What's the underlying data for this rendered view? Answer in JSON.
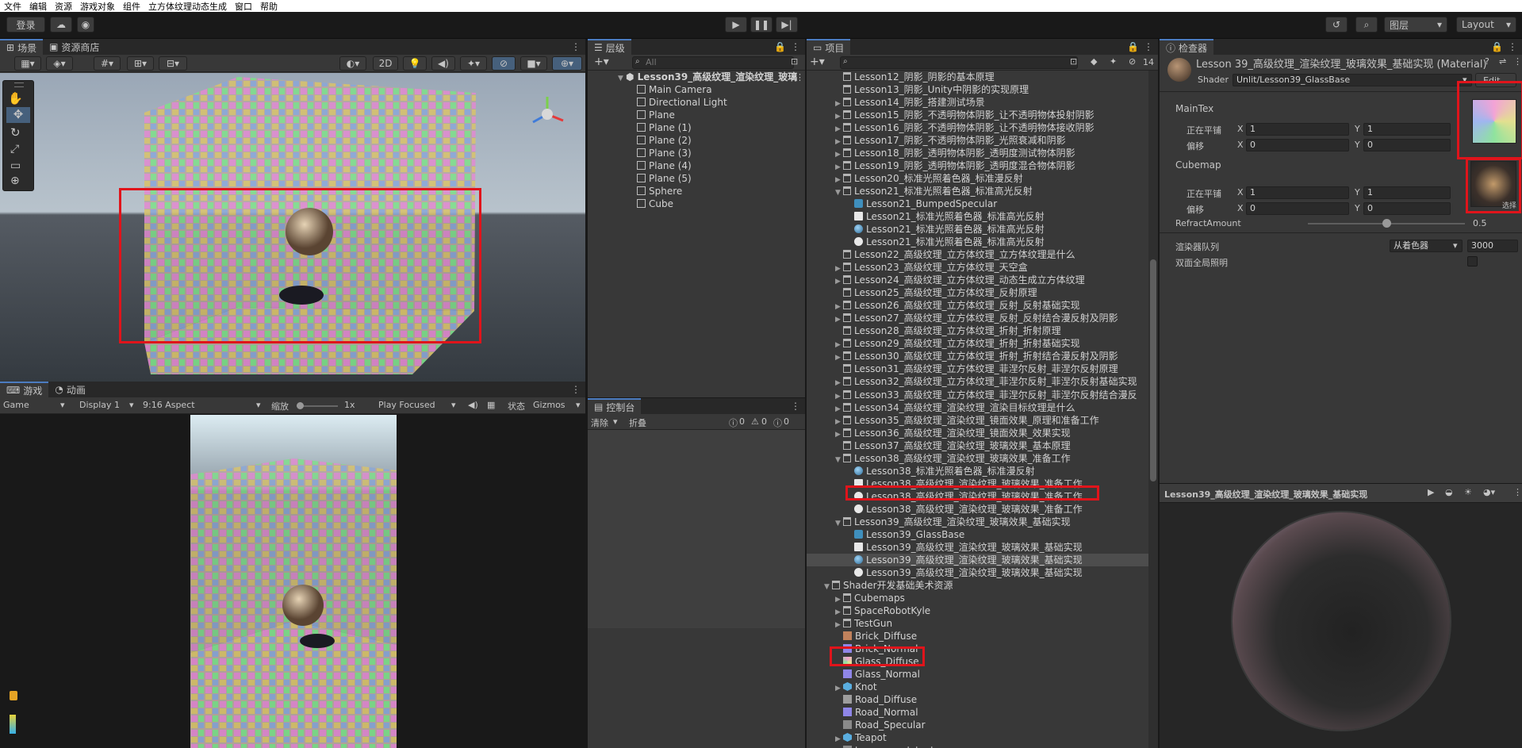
{
  "menu": [
    "文件",
    "编辑",
    "资源",
    "游戏对象",
    "组件",
    "立方体纹理动态生成",
    "窗口",
    "帮助"
  ],
  "toolbar": {
    "login": "登录",
    "layers": "图层",
    "layout": "Layout"
  },
  "scene_panel": {
    "tab_scene": "场景",
    "tab_store": "资源商店",
    "mode_2d": "2D"
  },
  "game_panel": {
    "tab_game": "游戏",
    "tab_animation": "动画",
    "game_select": "Game",
    "display": "Display 1",
    "aspect": "9:16 Aspect",
    "scale_label": "缩放",
    "scale_value": "1x",
    "play_focused": "Play Focused",
    "stats": "状态",
    "gizmos": "Gizmos"
  },
  "hierarchy": {
    "tab": "层级",
    "search_placeholder": "All",
    "scene_name": "Lesson39_高级纹理_渲染纹理_玻璃",
    "items": [
      "Main Camera",
      "Directional Light",
      "Plane",
      "Plane (1)",
      "Plane (2)",
      "Plane (3)",
      "Plane (4)",
      "Plane (5)",
      "Sphere",
      "Cube"
    ]
  },
  "console": {
    "tab": "控制台",
    "clear": "清除",
    "collapse": "折叠",
    "count_log": "0",
    "count_warn": "0",
    "count_err": "0"
  },
  "project": {
    "tab": "项目",
    "item_count": "14",
    "items": [
      {
        "text": "Lesson12_阴影_阴影的基本原理",
        "indent": 1,
        "kind": "folder",
        "arrow": ""
      },
      {
        "text": "Lesson13_阴影_Unity中阴影的实现原理",
        "indent": 1,
        "kind": "folder",
        "arrow": ""
      },
      {
        "text": "Lesson14_阴影_搭建测试场景",
        "indent": 1,
        "kind": "folder",
        "arrow": "▶"
      },
      {
        "text": "Lesson15_阴影_不透明物体阴影_让不透明物体投射阴影",
        "indent": 1,
        "kind": "folder",
        "arrow": "▶"
      },
      {
        "text": "Lesson16_阴影_不透明物体阴影_让不透明物体接收阴影",
        "indent": 1,
        "kind": "folder",
        "arrow": "▶"
      },
      {
        "text": "Lesson17_阴影_不透明物体阴影_光照衰减和阴影",
        "indent": 1,
        "kind": "folder",
        "arrow": "▶"
      },
      {
        "text": "Lesson18_阴影_透明物体阴影_透明度测试物体阴影",
        "indent": 1,
        "kind": "folder",
        "arrow": "▶"
      },
      {
        "text": "Lesson19_阴影_透明物体阴影_透明度混合物体阴影",
        "indent": 1,
        "kind": "folder",
        "arrow": "▶"
      },
      {
        "text": "Lesson20_标准光照着色器_标准漫反射",
        "indent": 1,
        "kind": "folder",
        "arrow": "▶"
      },
      {
        "text": "Lesson21_标准光照着色器_标准高光反射",
        "indent": 1,
        "kind": "folder",
        "arrow": "▼"
      },
      {
        "text": "Lesson21_BumpedSpecular",
        "indent": 2,
        "kind": "script",
        "arrow": ""
      },
      {
        "text": "Lesson21_标准光照着色器_标准高光反射",
        "indent": 2,
        "kind": "shader",
        "arrow": ""
      },
      {
        "text": "Lesson21_标准光照着色器_标准高光反射",
        "indent": 2,
        "kind": "material",
        "arrow": ""
      },
      {
        "text": "Lesson21_标准光照着色器_标准高光反射",
        "indent": 2,
        "kind": "scene",
        "arrow": ""
      },
      {
        "text": "Lesson22_高级纹理_立方体纹理_立方体纹理是什么",
        "indent": 1,
        "kind": "folder",
        "arrow": ""
      },
      {
        "text": "Lesson23_高级纹理_立方体纹理_天空盒",
        "indent": 1,
        "kind": "folder",
        "arrow": "▶"
      },
      {
        "text": "Lesson24_高级纹理_立方体纹理_动态生成立方体纹理",
        "indent": 1,
        "kind": "folder",
        "arrow": "▶"
      },
      {
        "text": "Lesson25_高级纹理_立方体纹理_反射原理",
        "indent": 1,
        "kind": "folder",
        "arrow": ""
      },
      {
        "text": "Lesson26_高级纹理_立方体纹理_反射_反射基础实现",
        "indent": 1,
        "kind": "folder",
        "arrow": "▶"
      },
      {
        "text": "Lesson27_高级纹理_立方体纹理_反射_反射结合漫反射及阴影",
        "indent": 1,
        "kind": "folder",
        "arrow": "▶"
      },
      {
        "text": "Lesson28_高级纹理_立方体纹理_折射_折射原理",
        "indent": 1,
        "kind": "folder",
        "arrow": ""
      },
      {
        "text": "Lesson29_高级纹理_立方体纹理_折射_折射基础实现",
        "indent": 1,
        "kind": "folder",
        "arrow": "▶"
      },
      {
        "text": "Lesson30_高级纹理_立方体纹理_折射_折射结合漫反射及阴影",
        "indent": 1,
        "kind": "folder",
        "arrow": "▶"
      },
      {
        "text": "Lesson31_高级纹理_立方体纹理_菲涅尔反射_菲涅尔反射原理",
        "indent": 1,
        "kind": "folder",
        "arrow": ""
      },
      {
        "text": "Lesson32_高级纹理_立方体纹理_菲涅尔反射_菲涅尔反射基础实现",
        "indent": 1,
        "kind": "folder",
        "arrow": "▶"
      },
      {
        "text": "Lesson33_高级纹理_立方体纹理_菲涅尔反射_菲涅尔反射结合漫反",
        "indent": 1,
        "kind": "folder",
        "arrow": "▶"
      },
      {
        "text": "Lesson34_高级纹理_渲染纹理_渲染目标纹理是什么",
        "indent": 1,
        "kind": "folder",
        "arrow": "▶"
      },
      {
        "text": "Lesson35_高级纹理_渲染纹理_镜面效果_原理和准备工作",
        "indent": 1,
        "kind": "folder",
        "arrow": "▶"
      },
      {
        "text": "Lesson36_高级纹理_渲染纹理_镜面效果_效果实现",
        "indent": 1,
        "kind": "folder",
        "arrow": "▶"
      },
      {
        "text": "Lesson37_高级纹理_渲染纹理_玻璃效果_基本原理",
        "indent": 1,
        "kind": "folder",
        "arrow": ""
      },
      {
        "text": "Lesson38_高级纹理_渲染纹理_玻璃效果_准备工作",
        "indent": 1,
        "kind": "folder",
        "arrow": "▼"
      },
      {
        "text": "Lesson38_标准光照着色器_标准漫反射",
        "indent": 2,
        "kind": "material",
        "arrow": ""
      },
      {
        "text": "Lesson38_高级纹理_渲染纹理_玻璃效果_准备工作",
        "indent": 2,
        "kind": "shader",
        "arrow": ""
      },
      {
        "text": "Lesson38_高级纹理_渲染纹理_玻璃效果_准备工作",
        "indent": 2,
        "kind": "scene",
        "arrow": ""
      },
      {
        "text": "Lesson38_高级纹理_渲染纹理_玻璃效果_准备工作",
        "indent": 2,
        "kind": "scene",
        "arrow": ""
      },
      {
        "text": "Lesson39_高级纹理_渲染纹理_玻璃效果_基础实现",
        "indent": 1,
        "kind": "folder",
        "arrow": "▼"
      },
      {
        "text": "Lesson39_GlassBase",
        "indent": 2,
        "kind": "script",
        "arrow": ""
      },
      {
        "text": "Lesson39_高级纹理_渲染纹理_玻璃效果_基础实现",
        "indent": 2,
        "kind": "shader",
        "arrow": ""
      },
      {
        "text": "Lesson39_高级纹理_渲染纹理_玻璃效果_基础实现",
        "indent": 2,
        "kind": "material",
        "arrow": "",
        "selected": true
      },
      {
        "text": "Lesson39_高级纹理_渲染纹理_玻璃效果_基础实现",
        "indent": 2,
        "kind": "scene",
        "arrow": ""
      },
      {
        "text": "Shader开发基础美术资源",
        "indent": 0,
        "kind": "folder",
        "arrow": "▼"
      },
      {
        "text": "Cubemaps",
        "indent": 1,
        "kind": "folder",
        "arrow": "▶"
      },
      {
        "text": "SpaceRobotKyle",
        "indent": 1,
        "kind": "folder",
        "arrow": "▶"
      },
      {
        "text": "TestGun",
        "indent": 1,
        "kind": "folder",
        "arrow": "▶"
      },
      {
        "text": "Brick_Diffuse",
        "indent": 1,
        "kind": "tex-brick",
        "arrow": ""
      },
      {
        "text": "Brick_Normal",
        "indent": 1,
        "kind": "tex-normal",
        "arrow": ""
      },
      {
        "text": "Glass_Diffuse",
        "indent": 1,
        "kind": "tex-glass",
        "arrow": ""
      },
      {
        "text": "Glass_Normal",
        "indent": 1,
        "kind": "tex-normal",
        "arrow": ""
      },
      {
        "text": "Knot",
        "indent": 1,
        "kind": "model",
        "arrow": "▶"
      },
      {
        "text": "Road_Diffuse",
        "indent": 1,
        "kind": "tex-road",
        "arrow": ""
      },
      {
        "text": "Road_Normal",
        "indent": 1,
        "kind": "tex-normal",
        "arrow": ""
      },
      {
        "text": "Road_Specular",
        "indent": 1,
        "kind": "tex-spec",
        "arrow": ""
      },
      {
        "text": "Teapot",
        "indent": 1,
        "kind": "model",
        "arrow": "▶"
      },
      {
        "text": "transparent_texture",
        "indent": 1,
        "kind": "tex-spec",
        "arrow": ""
      }
    ]
  },
  "inspector": {
    "tab": "检查器",
    "title": "Lesson 39_高级纹理_渲染纹理_玻璃效果_基础实现 (Material)",
    "shader_label": "Shader",
    "shader_value": "Unlit/Lesson39_GlassBase",
    "edit": "Edit...",
    "maintex": "MainTex",
    "tiling": "正在平铺",
    "offset": "偏移",
    "x": "X",
    "y": "Y",
    "tiling_x": "1",
    "tiling_y": "1",
    "offset_x": "0",
    "offset_y": "0",
    "cubemap": "Cubemap",
    "cube_tiling_x": "1",
    "cube_tiling_y": "1",
    "cube_offset_x": "0",
    "cube_offset_y": "0",
    "select": "选择",
    "refract_label": "RefractAmount",
    "refract_value": "0.5",
    "refract_level": 0.5,
    "queue_label": "渲染器队列",
    "queue_source": "从着色器",
    "queue_value": "3000",
    "double_gi": "双面全局照明",
    "preview_title": "Lesson39_高级纹理_渲染纹理_玻璃效果_基础实现"
  }
}
